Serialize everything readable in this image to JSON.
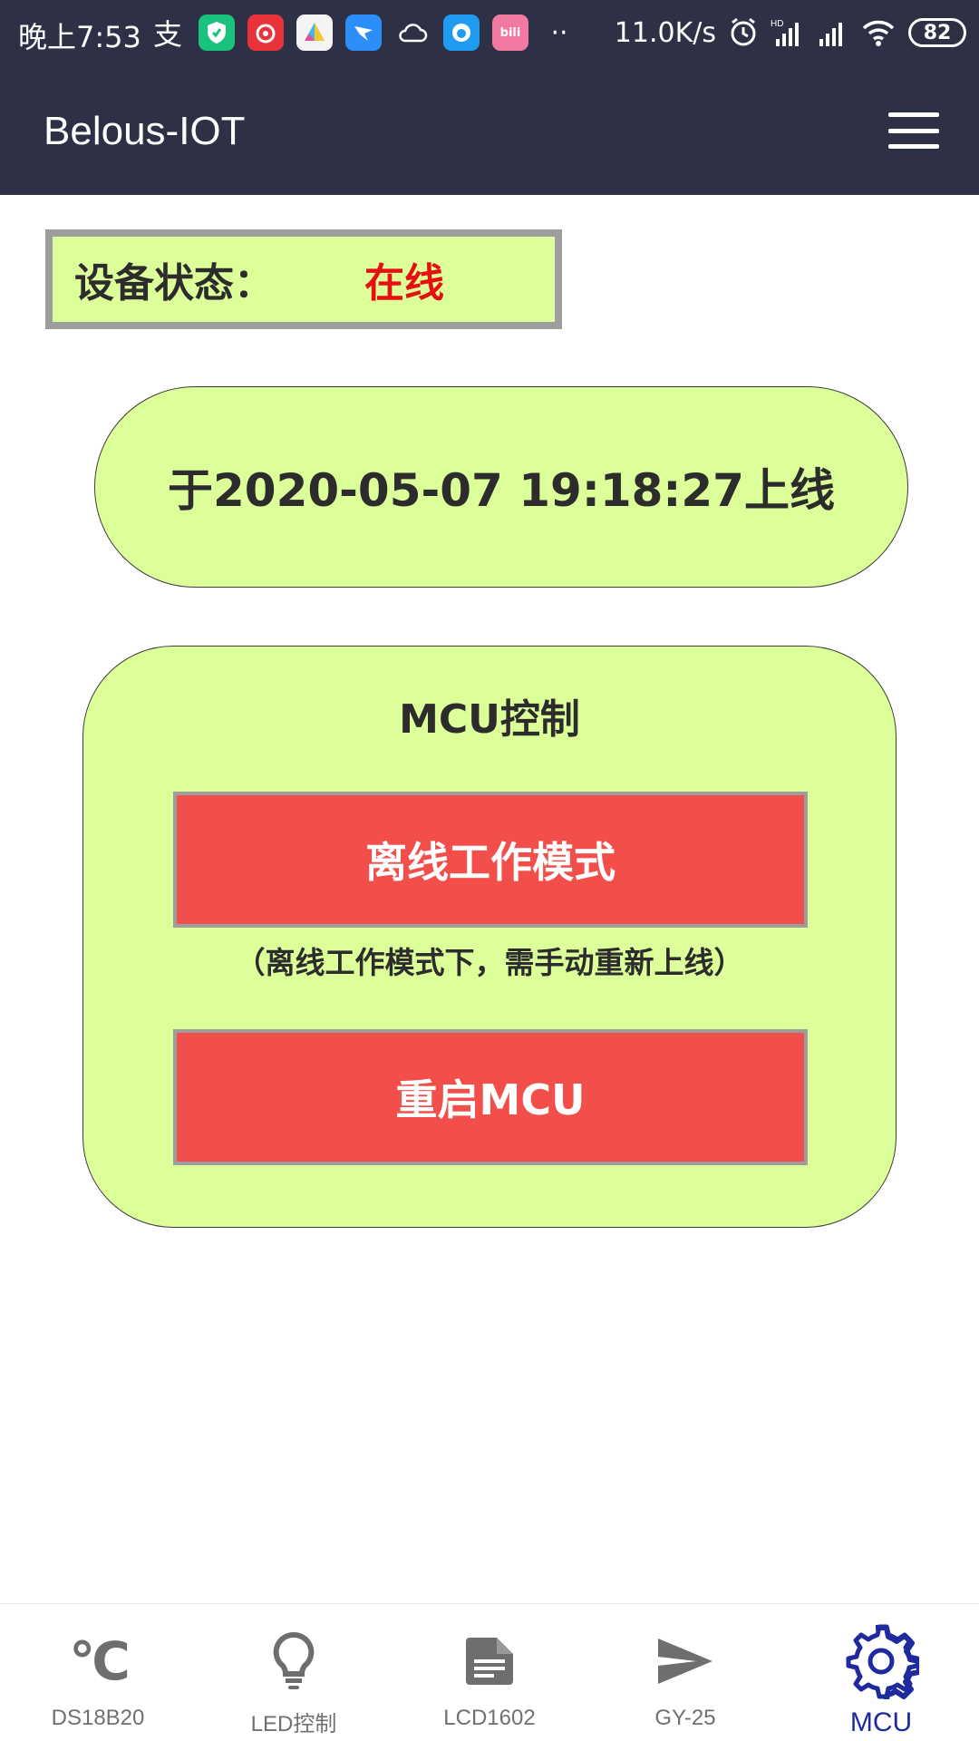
{
  "status_bar": {
    "time": "晚上7:53",
    "speed": "11.0K/s",
    "battery": "82",
    "icons": [
      "alipay-icon",
      "shield-app-icon",
      "netease-music-icon",
      "photos-app-icon",
      "dingtalk-icon",
      "cloud-icon",
      "qq-app-icon",
      "bilibili-icon",
      "more-dots-icon",
      "alarm-icon",
      "hd-signal-icon",
      "signal-icon",
      "wifi-icon"
    ]
  },
  "app_bar": {
    "title": "Belous-IOT"
  },
  "device_status": {
    "label": "设备状态：",
    "value": "在线",
    "value_color": "#e61010"
  },
  "online_info": {
    "text": "于2020-05-07 19:18:27上线"
  },
  "mcu_panel": {
    "title": "MCU控制",
    "offline_button": "离线工作模式",
    "note": "（离线工作模式下，需手动重新上线）",
    "restart_button": "重启MCU"
  },
  "bottom_nav": {
    "active_color": "#1e2a9e",
    "items": [
      {
        "label": "DS18B20",
        "icon": "celsius-icon",
        "icon_text": "°C"
      },
      {
        "label": "LED控制",
        "icon": "lightbulb-icon"
      },
      {
        "label": "LCD1602",
        "icon": "document-icon"
      },
      {
        "label": "GY-25",
        "icon": "send-icon"
      },
      {
        "label": "MCU",
        "icon": "gear-icon",
        "active": true
      }
    ]
  },
  "colors": {
    "app_bar": "#2e3046",
    "panel_fill": "#dcff9a",
    "button_red": "#f24e4a"
  }
}
